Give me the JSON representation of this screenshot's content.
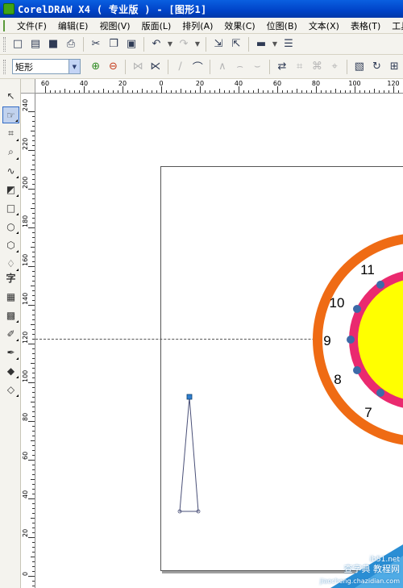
{
  "window": {
    "title": "CorelDRAW X4 ( 专业版 ) - [图形1]"
  },
  "menu": [
    "文件(F)",
    "编辑(E)",
    "视图(V)",
    "版面(L)",
    "排列(A)",
    "效果(C)",
    "位图(B)",
    "文本(X)",
    "表格(T)",
    "工具"
  ],
  "property_bar": {
    "shape_select": "矩形"
  },
  "rulers": {
    "horizontal": [
      "60",
      "40",
      "20",
      "0",
      "20",
      "40",
      "60",
      "80",
      "100",
      "120"
    ],
    "vertical": [
      "240",
      "220",
      "200",
      "180",
      "160",
      "140",
      "120",
      "100",
      "80",
      "60",
      "40",
      "20",
      "0"
    ]
  },
  "clock": {
    "numbers": [
      "11",
      "10",
      "9",
      "8",
      "7"
    ],
    "colors": {
      "outer_ring": "#ef6b14",
      "pink_ring": "#ea2a6f",
      "center": "#ffff00",
      "dots": "#3d6aa8"
    }
  },
  "watermark": {
    "line1": "ib51.net",
    "line2": "查字典 教程网",
    "line3": "jiaocheng.chazidian.com"
  },
  "toolbox_icons": [
    "pick-tool-icon",
    "shape-tool-icon",
    "crop-tool-icon",
    "zoom-tool-icon",
    "freehand-tool-icon",
    "smart-fill-icon",
    "rectangle-tool-icon",
    "ellipse-tool-icon",
    "polygon-tool-icon",
    "basic-shapes-icon",
    "text-tool-icon",
    "table-tool-icon",
    "interactive-blend-icon",
    "eyedropper-tool-icon",
    "outline-tool-icon",
    "fill-tool-icon",
    "interactive-fill-icon"
  ]
}
